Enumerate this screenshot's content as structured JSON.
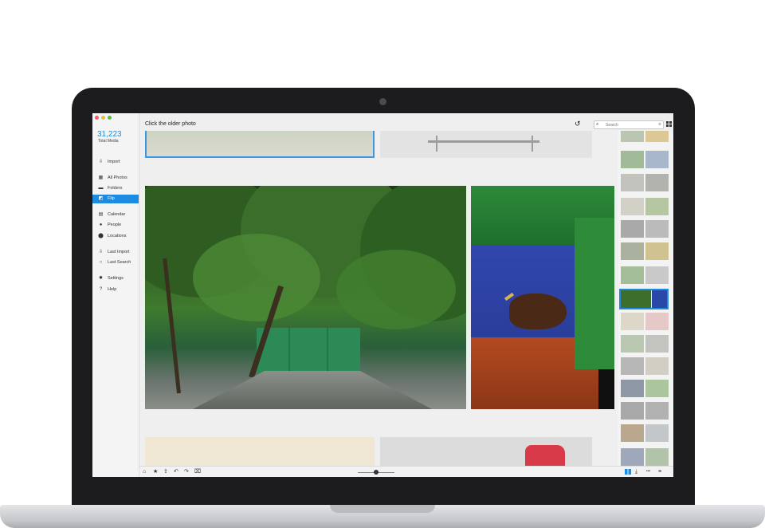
{
  "app": {
    "window_title": "Click the older photo",
    "total_count": "31,223",
    "total_label": "Total Media"
  },
  "sidebar": {
    "items": [
      {
        "label": "Import",
        "icon": "import-icon",
        "glyph": "⇩"
      },
      {
        "label": "All Photos",
        "icon": "photos-icon",
        "glyph": "▦"
      },
      {
        "label": "Folders",
        "icon": "folder-icon",
        "glyph": "▬"
      },
      {
        "label": "Flip",
        "icon": "flip-icon",
        "glyph": "◩",
        "active": true
      },
      {
        "label": "Calendar",
        "icon": "calendar-icon",
        "glyph": "▤"
      },
      {
        "label": "People",
        "icon": "person-icon",
        "glyph": "●"
      },
      {
        "label": "Locations",
        "icon": "location-pin-icon",
        "glyph": "⬤"
      },
      {
        "label": "Last Import",
        "icon": "last-import-icon",
        "glyph": "⇩"
      },
      {
        "label": "Last Search",
        "icon": "search-icon",
        "glyph": "○"
      },
      {
        "label": "Settings",
        "icon": "gear-icon",
        "glyph": "✹"
      },
      {
        "label": "Help",
        "icon": "help-icon",
        "glyph": "?"
      }
    ]
  },
  "toolbar": {
    "search_placeholder": "Search",
    "undo_glyph": "↺",
    "search_glyph": "⌕",
    "clear_glyph": "⊗"
  },
  "bottombar": {
    "left_icons": [
      {
        "name": "home-icon",
        "glyph": "⌂"
      },
      {
        "name": "star-icon",
        "glyph": "★"
      },
      {
        "name": "share-icon",
        "glyph": "⇪"
      },
      {
        "name": "rotate-left-icon",
        "glyph": "↶"
      },
      {
        "name": "rotate-right-icon",
        "glyph": "↷"
      },
      {
        "name": "trash-icon",
        "glyph": "⌧"
      }
    ],
    "right_icons": [
      {
        "name": "flip-view-icon",
        "glyph": "▮▮"
      },
      {
        "name": "export-icon",
        "glyph": "⤓"
      },
      {
        "name": "more-icon",
        "glyph": "•••"
      },
      {
        "name": "list-icon",
        "glyph": "≡"
      }
    ],
    "zoom_level": 0.5
  },
  "colors": {
    "accent": "#1c8be0",
    "sidebar_bg": "#f4f4f4",
    "content_bg": "#efefef"
  }
}
